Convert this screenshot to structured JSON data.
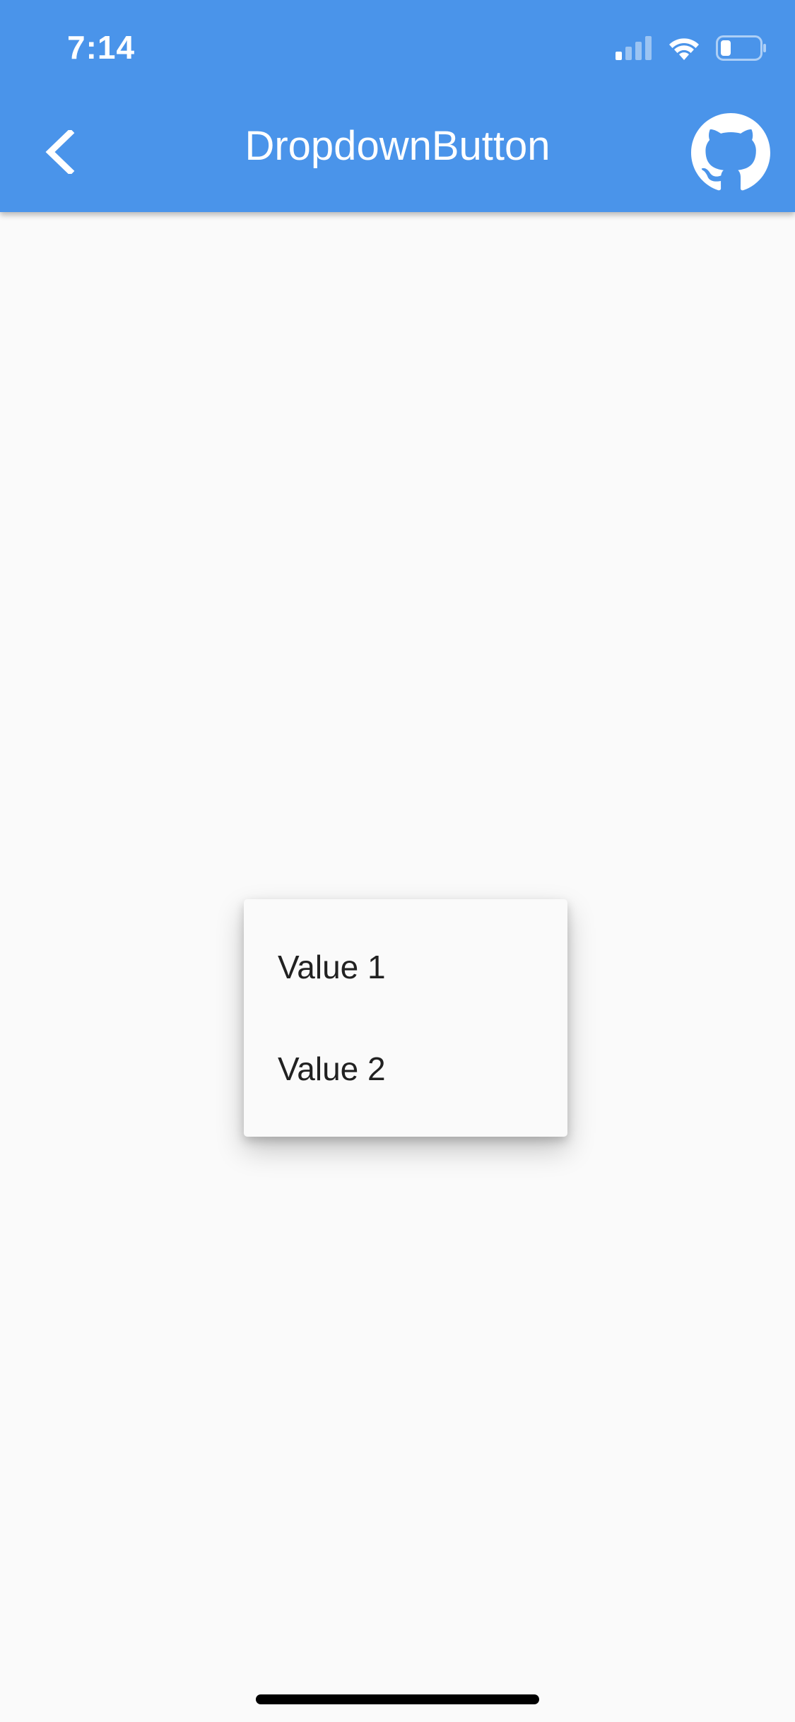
{
  "status_bar": {
    "time": "7:14",
    "icons": [
      "cellular-signal-icon",
      "wifi-icon",
      "battery-icon"
    ]
  },
  "app_bar": {
    "title": "DropdownButton",
    "back_icon": "chevron-left-icon",
    "action_icon": "github-icon",
    "background_color": "#4a94ea"
  },
  "dropdown": {
    "options": [
      "Value 1",
      "Value 2"
    ]
  },
  "colors": {
    "page_background": "#fafafa",
    "menu_text": "#212121"
  }
}
